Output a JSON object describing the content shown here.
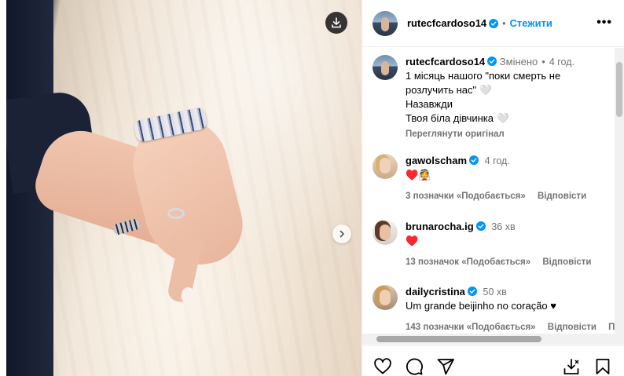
{
  "post": {
    "author": "rutecfcardoso14",
    "follow_label": "Стежити",
    "more_label": "•••",
    "caption_lines": [
      "1 місяць нашого \"поки смерть не розлучить нас\" 🤍",
      "Назавжди",
      "Твоя біла дівчинка 🤍"
    ],
    "edited_label": "Змінено",
    "time": "4 год.",
    "translate_label": "Переглянути оригінал"
  },
  "comments": [
    {
      "user": "gawolscham",
      "time": "4 год.",
      "text": "♥️👰",
      "likes": "3 позначки «Подобається»",
      "reply": "Відповісти"
    },
    {
      "user": "brunarocha.ig",
      "time": "36 хв",
      "text": "♥️",
      "likes": "13 позначок «Подобається»",
      "reply": "Відповісти"
    },
    {
      "user": "dailycristina",
      "time": "50 хв",
      "text": "Um grande beijinho no coração ♥",
      "likes": "143 позначки «Подобається»",
      "reply": "Відповісти",
      "extra": "Пер"
    }
  ],
  "icons": {
    "download": "download-icon",
    "next": "chevron-right-icon",
    "verified": "verified-badge-icon",
    "like": "heart-icon",
    "comment": "comment-icon",
    "share": "share-icon",
    "save": "bookmark-icon",
    "save_download": "download-save-icon"
  },
  "colors": {
    "link_blue": "#0095f6",
    "verified_blue": "#0095f6",
    "heart_red": "#c1121f",
    "muted": "#737373"
  }
}
